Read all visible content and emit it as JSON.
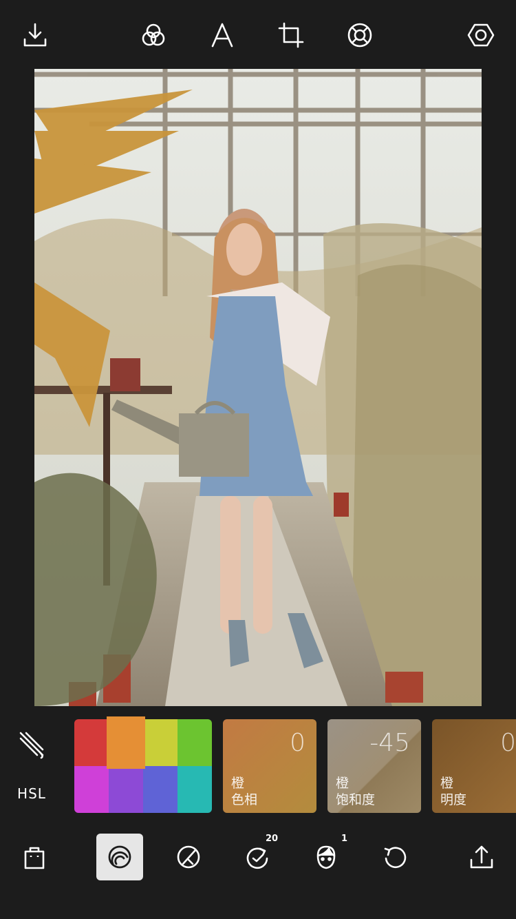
{
  "toolbar_top": {
    "icons": [
      "download-icon",
      "filters-icon",
      "text-icon",
      "crop-icon",
      "lifebuoy-icon",
      "settings-icon"
    ]
  },
  "hsl_panel": {
    "label": "HSL",
    "swatches": [
      {
        "color": "#d43a3a",
        "selected": false
      },
      {
        "color": "#e58f35",
        "selected": true
      },
      {
        "color": "#c9cf38",
        "selected": false
      },
      {
        "color": "#6cc430",
        "selected": false
      },
      {
        "color": "#cf40d8",
        "selected": false
      },
      {
        "color": "#8d4ad6",
        "selected": false
      },
      {
        "color": "#5f63d6",
        "selected": false
      },
      {
        "color": "#27b9b3",
        "selected": false
      }
    ],
    "adjustments": [
      {
        "value": "0",
        "color_name": "橙",
        "property": "色相"
      },
      {
        "value": "-45",
        "color_name": "橙",
        "property": "饱和度"
      },
      {
        "value": "0",
        "color_name": "橙",
        "property": "明度"
      }
    ]
  },
  "toolbar_bottom": {
    "icons": [
      "shopping-bag-icon",
      "hsl-tool-icon",
      "retouch-icon",
      "redo-count-icon",
      "face-icon",
      "undo-icon",
      "share-icon"
    ],
    "badges": {
      "redo": "20",
      "face": "1"
    },
    "active": "hsl-tool-icon"
  }
}
